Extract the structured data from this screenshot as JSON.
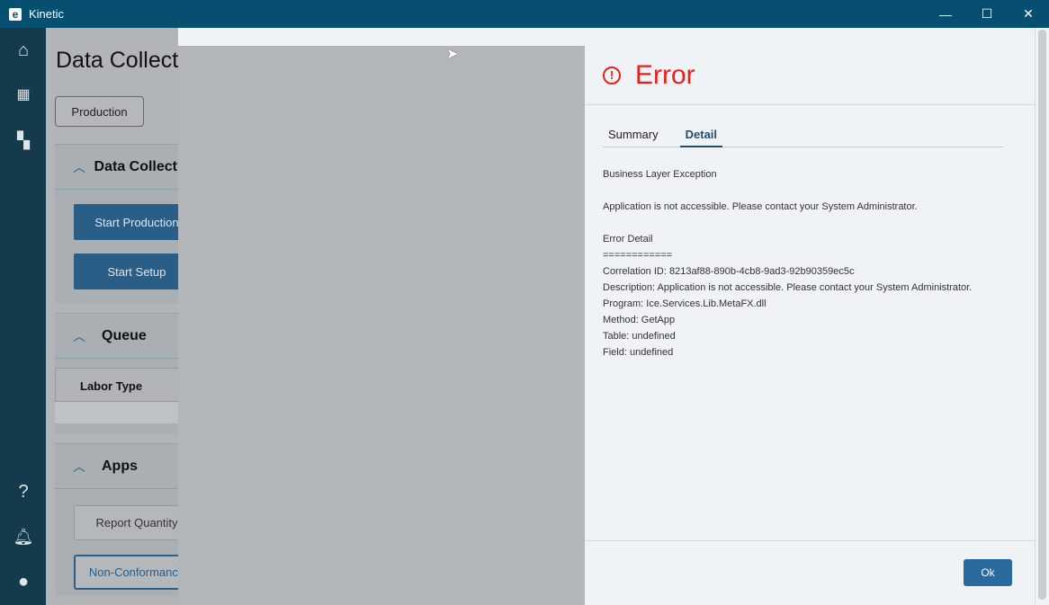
{
  "window": {
    "title": "Kinetic",
    "logo": "e",
    "minimize": "—",
    "maximize": "☐",
    "close": "✕"
  },
  "nav": {
    "items": [
      "home-icon",
      "apps-grid-icon",
      "dashboard-icon",
      "help-icon",
      "bell-icon",
      "user-icon"
    ]
  },
  "page": {
    "title": "Data Collection",
    "mode_button": "Production",
    "sections": [
      {
        "title": "Data Collection",
        "buttons": [
          "Start Production",
          "Start Setup"
        ]
      },
      {
        "title": "Queue",
        "column": "Labor Type"
      },
      {
        "title": "Apps",
        "buttons": [
          "Report Quantity",
          "Non-Conformance"
        ]
      }
    ]
  },
  "dialog": {
    "title": "Error",
    "tabs": [
      "Summary",
      "Detail"
    ],
    "active_tab": "Detail",
    "lines": [
      "Business Layer Exception",
      "",
      "Application is not accessible. Please contact your System Administrator.",
      "",
      "Error Detail",
      "============",
      "Correlation ID: 8213af88-890b-4cb8-9ad3-92b90359ec5c",
      "Description: Application is not accessible. Please contact your System Administrator.",
      "Program: Ice.Services.Lib.MetaFX.dll",
      "Method: GetApp",
      "Table: undefined",
      "Field: undefined"
    ],
    "ok_label": "Ok"
  },
  "colors": {
    "titlebar": "#064f70",
    "error": "#e8201c",
    "accent": "#2b6a9e"
  }
}
